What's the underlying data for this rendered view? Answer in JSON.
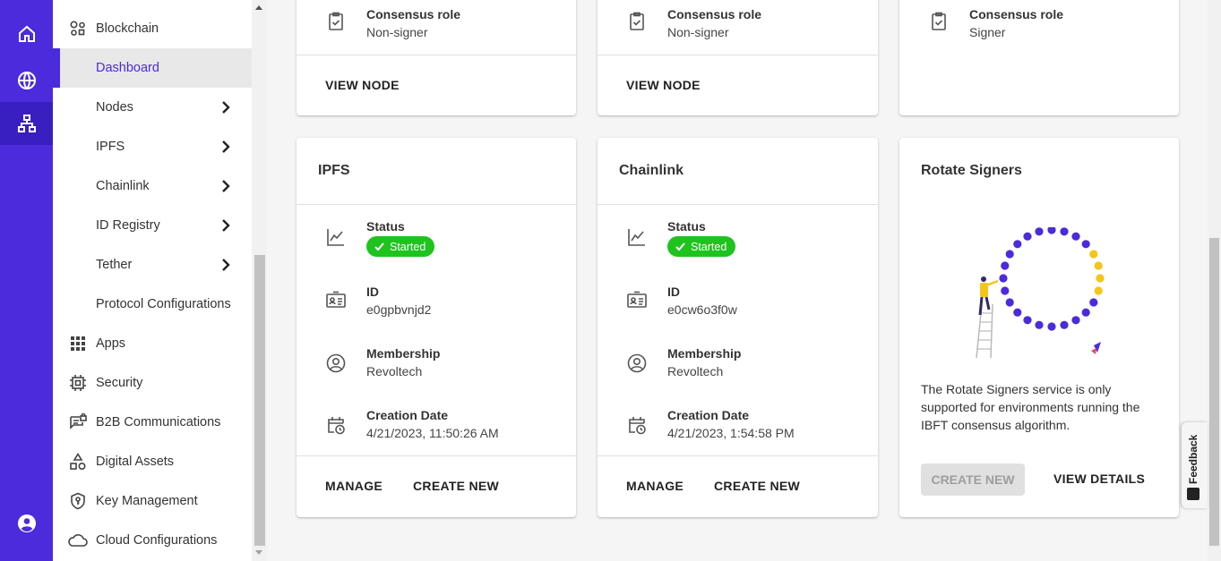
{
  "rail": {
    "items": [
      "home-icon",
      "globe-icon",
      "network-icon",
      "account-icon"
    ]
  },
  "sidebar": {
    "items": [
      {
        "label": "Blockchain",
        "icon": "blockchain-icon"
      },
      {
        "label": "Dashboard"
      },
      {
        "label": "Nodes"
      },
      {
        "label": "IPFS"
      },
      {
        "label": "Chainlink"
      },
      {
        "label": "ID Registry"
      },
      {
        "label": "Tether"
      },
      {
        "label": "Protocol Configurations"
      },
      {
        "label": "Apps",
        "icon": "apps-grid-icon"
      },
      {
        "label": "Security",
        "icon": "chip-icon"
      },
      {
        "label": "B2B Communications",
        "icon": "message-lock-icon"
      },
      {
        "label": "Digital Assets",
        "icon": "shapes-icon"
      },
      {
        "label": "Key Management",
        "icon": "shield-key-icon"
      },
      {
        "label": "Cloud Configurations",
        "icon": "cloud-icon"
      }
    ]
  },
  "top_cards": [
    {
      "label": "Consensus role",
      "value": "Non-signer",
      "action": "VIEW NODE"
    },
    {
      "label": "Consensus role",
      "value": "Non-signer",
      "action": "VIEW NODE"
    },
    {
      "label": "Consensus role",
      "value": "Signer"
    }
  ],
  "ipfs": {
    "title": "IPFS",
    "status_label": "Status",
    "status": "Started",
    "id_label": "ID",
    "id": "e0gpbvnjd2",
    "membership_label": "Membership",
    "membership": "Revoltech",
    "date_label": "Creation Date",
    "date": "4/21/2023, 11:50:26 AM",
    "manage": "MANAGE",
    "create": "CREATE NEW"
  },
  "chainlink": {
    "title": "Chainlink",
    "status_label": "Status",
    "status": "Started",
    "id_label": "ID",
    "id": "e0cw6o3f0w",
    "membership_label": "Membership",
    "membership": "Revoltech",
    "date_label": "Creation Date",
    "date": "4/21/2023, 1:54:58 PM",
    "manage": "MANAGE",
    "create": "CREATE NEW"
  },
  "rotate": {
    "title": "Rotate Signers",
    "description": "The Rotate Signers service is only supported for environments running the IBFT consensus algorithm.",
    "create": "CREATE NEW",
    "details": "VIEW DETAILS"
  },
  "feedback": "Feedback",
  "colors": {
    "brand": "#4b2bdb",
    "status_green": "#1ec31e",
    "dot_yellow": "#f5c518"
  }
}
